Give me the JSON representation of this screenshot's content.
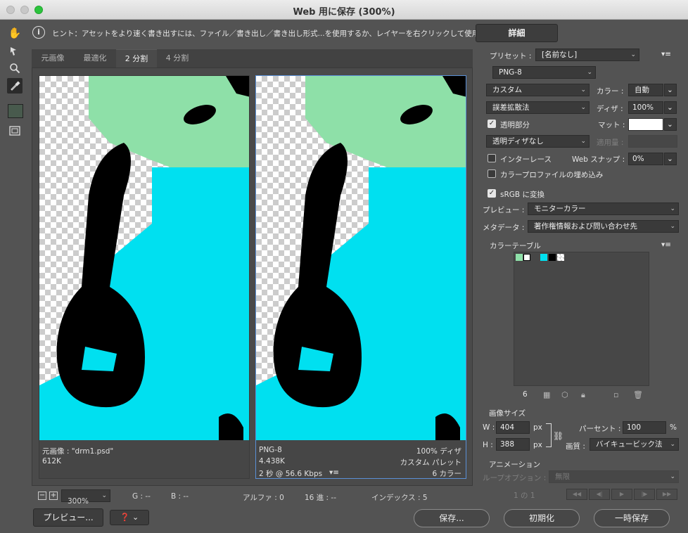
{
  "window": {
    "title": "Web 用に保存 (300%)"
  },
  "hint": {
    "text": "ヒント：アセットをより速く書き出すには、ファイル／書き出し／書き出し形式...を使用するか、レイヤーを右クリックして使用。",
    "detail_button": "詳細"
  },
  "tabs": [
    {
      "label": "元画像"
    },
    {
      "label": "最適化"
    },
    {
      "label": "2 分割"
    },
    {
      "label": "4 分割"
    }
  ],
  "left_pane": {
    "name": "元画像 : \"drm1.psd\"",
    "size": "612K"
  },
  "right_pane": {
    "format": "PNG-8",
    "size": "4.438K",
    "time": "2 秒 @ 56.6 Kbps",
    "dither": "100% ディザ",
    "palette": "カスタム パレット",
    "colors": "6 カラー"
  },
  "status": {
    "zoom": "300%",
    "g": "G : --",
    "b": "B : --",
    "alpha": "アルファ : 0",
    "hex": "16 進 : --",
    "index": "インデックス : 5"
  },
  "bottom": {
    "preview": "プレビュー...",
    "save": "保存...",
    "reset": "初期化",
    "remember": "一時保存"
  },
  "settings": {
    "preset_label": "プリセット :",
    "preset_value": "[名前なし]",
    "format": "PNG-8",
    "reduction": "カスタム",
    "colors_label": "カラー :",
    "colors_value": "自動",
    "dither_algo": "誤差拡散法",
    "dither_label": "ディザ :",
    "dither_value": "100%",
    "transparency_label": "透明部分",
    "matte_label": "マット :",
    "trans_dither": "透明ディザなし",
    "amount_label": "適用量 :",
    "interlace_label": "インターレース",
    "websnap_label": "Web スナップ :",
    "websnap_value": "0%",
    "embed_profile_label": "カラープロファイルの埋め込み",
    "srgb_label": "sRGB に変換",
    "preview_label": "プレビュー :",
    "preview_value": "モニターカラー",
    "metadata_label": "メタデータ :",
    "metadata_value": "著作権情報および問い合わせ先"
  },
  "color_table": {
    "title": "カラーテーブル",
    "count": "6",
    "swatches": [
      "#8ee0a8",
      "#ffffff",
      "#00e0f0",
      "#000000"
    ]
  },
  "image_size": {
    "title": "画像サイズ",
    "w_label": "W :",
    "w_value": "404",
    "w_unit": "px",
    "h_label": "H :",
    "h_value": "388",
    "h_unit": "px",
    "percent_label": "パーセント :",
    "percent_value": "100",
    "percent_unit": "%",
    "quality_label": "画質 :",
    "quality_value": "バイキュービック法"
  },
  "animation": {
    "title": "アニメーション",
    "loop_label": "ループオプション :",
    "loop_value": "無限",
    "frame": "1 の 1"
  },
  "colors": {
    "green": "#8ee0a8",
    "cyan": "#00e0f0",
    "accent": "#5a8fd6"
  }
}
